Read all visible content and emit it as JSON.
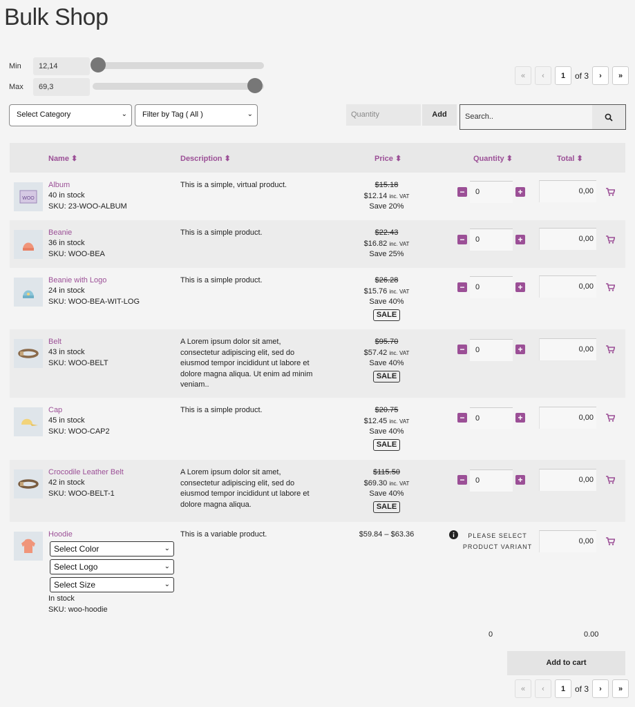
{
  "page": {
    "title": "Bulk Shop"
  },
  "range": {
    "min_label": "Min",
    "min_value": "12,14",
    "max_label": "Max",
    "max_value": "69,3"
  },
  "pagination": {
    "first": "«",
    "prev": "‹",
    "current": "1",
    "of": "of 3",
    "next": "›",
    "last": "»"
  },
  "filters": {
    "category": "Select Category",
    "tag": "Filter by Tag ( All )"
  },
  "quick_add": {
    "quantity_placeholder": "Quantity",
    "add_label": "Add"
  },
  "search": {
    "placeholder": "Search.."
  },
  "columns": {
    "name": "Name",
    "description": "Description",
    "price": "Price",
    "quantity": "Quantity",
    "total": "Total"
  },
  "products": [
    {
      "name": "Album",
      "stock": "40 in stock",
      "sku": "SKU: 23-WOO-ALBUM",
      "description": "This is a simple, virtual product.",
      "old_price": "$15.18",
      "price": "$12.14",
      "vat": "inc. VAT",
      "save": "Save 20%",
      "sale": "",
      "qty": "0",
      "total": "0,00"
    },
    {
      "name": "Beanie",
      "stock": "36 in stock",
      "sku": "SKU: WOO-BEA",
      "description": "This is a simple product.",
      "old_price": "$22.43",
      "price": "$16.82",
      "vat": "inc. VAT",
      "save": "Save 25%",
      "sale": "",
      "qty": "0",
      "total": "0,00"
    },
    {
      "name": "Beanie with Logo",
      "stock": "24 in stock",
      "sku": "SKU: WOO-BEA-WIT-LOG",
      "description": "This is a simple product.",
      "old_price": "$26.28",
      "price": "$15.76",
      "vat": "inc. VAT",
      "save": "Save 40%",
      "sale": "SALE",
      "qty": "0",
      "total": "0,00"
    },
    {
      "name": "Belt",
      "stock": "43 in stock",
      "sku": "SKU: WOO-BELT",
      "description": "A Lorem ipsum dolor sit amet, consectetur adipiscing elit, sed do eiusmod tempor incididunt ut labore et dolore magna aliqua. Ut enim ad minim veniam..",
      "old_price": "$95.70",
      "price": "$57.42",
      "vat": "inc. VAT",
      "save": "Save 40%",
      "sale": "SALE",
      "qty": "0",
      "total": "0,00"
    },
    {
      "name": "Cap",
      "stock": "45 in stock",
      "sku": "SKU: WOO-CAP2",
      "description": "This is a simple product.",
      "old_price": "$20.75",
      "price": "$12.45",
      "vat": "inc. VAT",
      "save": "Save 40%",
      "sale": "SALE",
      "qty": "0",
      "total": "0,00"
    },
    {
      "name": "Crocodile Leather Belt",
      "stock": "42 in stock",
      "sku": "SKU: WOO-BELT-1",
      "description": "A Lorem ipsum dolor sit amet, consectetur adipiscing elit, sed do eiusmod tempor incididunt ut labore et dolore magna aliqua.",
      "old_price": "$115.50",
      "price": "$69.30",
      "vat": "inc. VAT",
      "save": "Save 40%",
      "sale": "SALE",
      "qty": "0",
      "total": "0,00"
    }
  ],
  "variable_product": {
    "name": "Hoodie",
    "select_color": "Select Color",
    "select_logo": "Select Logo",
    "select_size": "Select Size",
    "stock": "In stock",
    "sku": "SKU: woo-hoodie",
    "description": "This is a variable product.",
    "price_range": "$59.84 – $63.36",
    "note": "PLEASE SELECT PRODUCT VARIANT",
    "total": "0,00"
  },
  "footer": {
    "qty_total": "0",
    "amount_total": "0.00",
    "add_to_cart": "Add to cart"
  },
  "colors": {
    "accent": "#9b4f96",
    "background": "#f4f4f4"
  },
  "icons": {
    "search": "search-icon",
    "cart": "cart-icon",
    "info": "info-icon",
    "sort": "sort-icon"
  }
}
